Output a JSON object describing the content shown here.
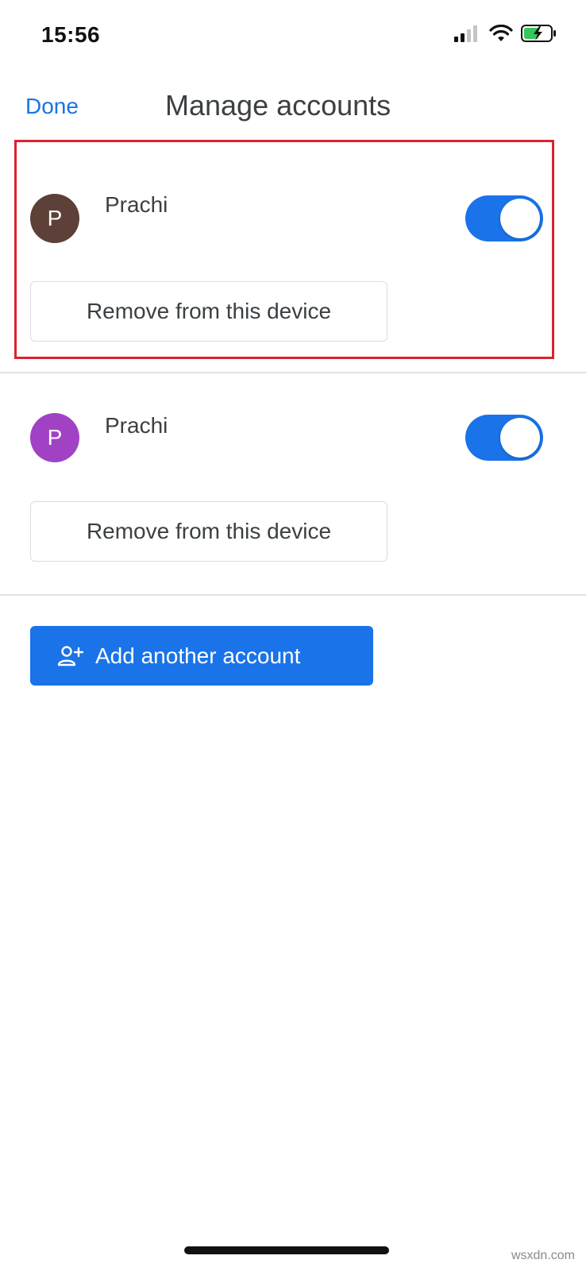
{
  "status_bar": {
    "time": "15:56",
    "icons": [
      "signal-icon",
      "wifi-icon",
      "battery-charging-icon"
    ]
  },
  "header": {
    "done_label": "Done",
    "title": "Manage accounts"
  },
  "accounts": [
    {
      "initial": "P",
      "name": "Prachi",
      "avatar_color": "#5d4037",
      "toggle_on": true,
      "remove_label": "Remove from this device",
      "highlighted": true
    },
    {
      "initial": "P",
      "name": "Prachi",
      "avatar_color": "#a142c5",
      "toggle_on": true,
      "remove_label": "Remove from this device",
      "highlighted": false
    }
  ],
  "add_account": {
    "label": "Add another account",
    "icon": "add-person-icon"
  },
  "watermark": "wsxdn.com",
  "colors": {
    "accent": "#1a73e8",
    "highlight": "#d9242f",
    "text": "#3c4043"
  }
}
